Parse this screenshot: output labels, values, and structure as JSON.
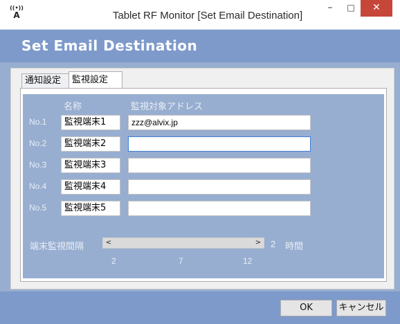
{
  "window": {
    "title": "Tablet RF Monitor [Set Email Destination]",
    "icon": "antenna-icon",
    "minimize_glyph": "–",
    "maximize_glyph": "□",
    "close_glyph": "✕"
  },
  "header": {
    "title": "Set Email Destination"
  },
  "tabs": [
    {
      "label": "通知設定",
      "selected": false
    },
    {
      "label": "監視設定",
      "selected": true
    }
  ],
  "monitor": {
    "name_header": "名称",
    "address_header": "監視対象アドレス",
    "rows": [
      {
        "label": "No.1",
        "name": "監視端末1",
        "address": "zzz@alvix.jp"
      },
      {
        "label": "No.2",
        "name": "監視端末2",
        "address": ""
      },
      {
        "label": "No.3",
        "name": "監視端末3",
        "address": ""
      },
      {
        "label": "No.4",
        "name": "監視端末4",
        "address": ""
      },
      {
        "label": "No.5",
        "name": "監視端末5",
        "address": ""
      }
    ],
    "interval": {
      "label": "端末監視間隔",
      "value": "2",
      "unit": "時間",
      "ticks": [
        "2",
        "7",
        "12"
      ],
      "left_arrow": "<",
      "right_arrow": ">"
    }
  },
  "buttons": {
    "ok": "OK",
    "cancel": "キャンセル"
  },
  "colors": {
    "frame": "#97aed0",
    "header": "#7e9acb",
    "close": "#c7463a"
  }
}
